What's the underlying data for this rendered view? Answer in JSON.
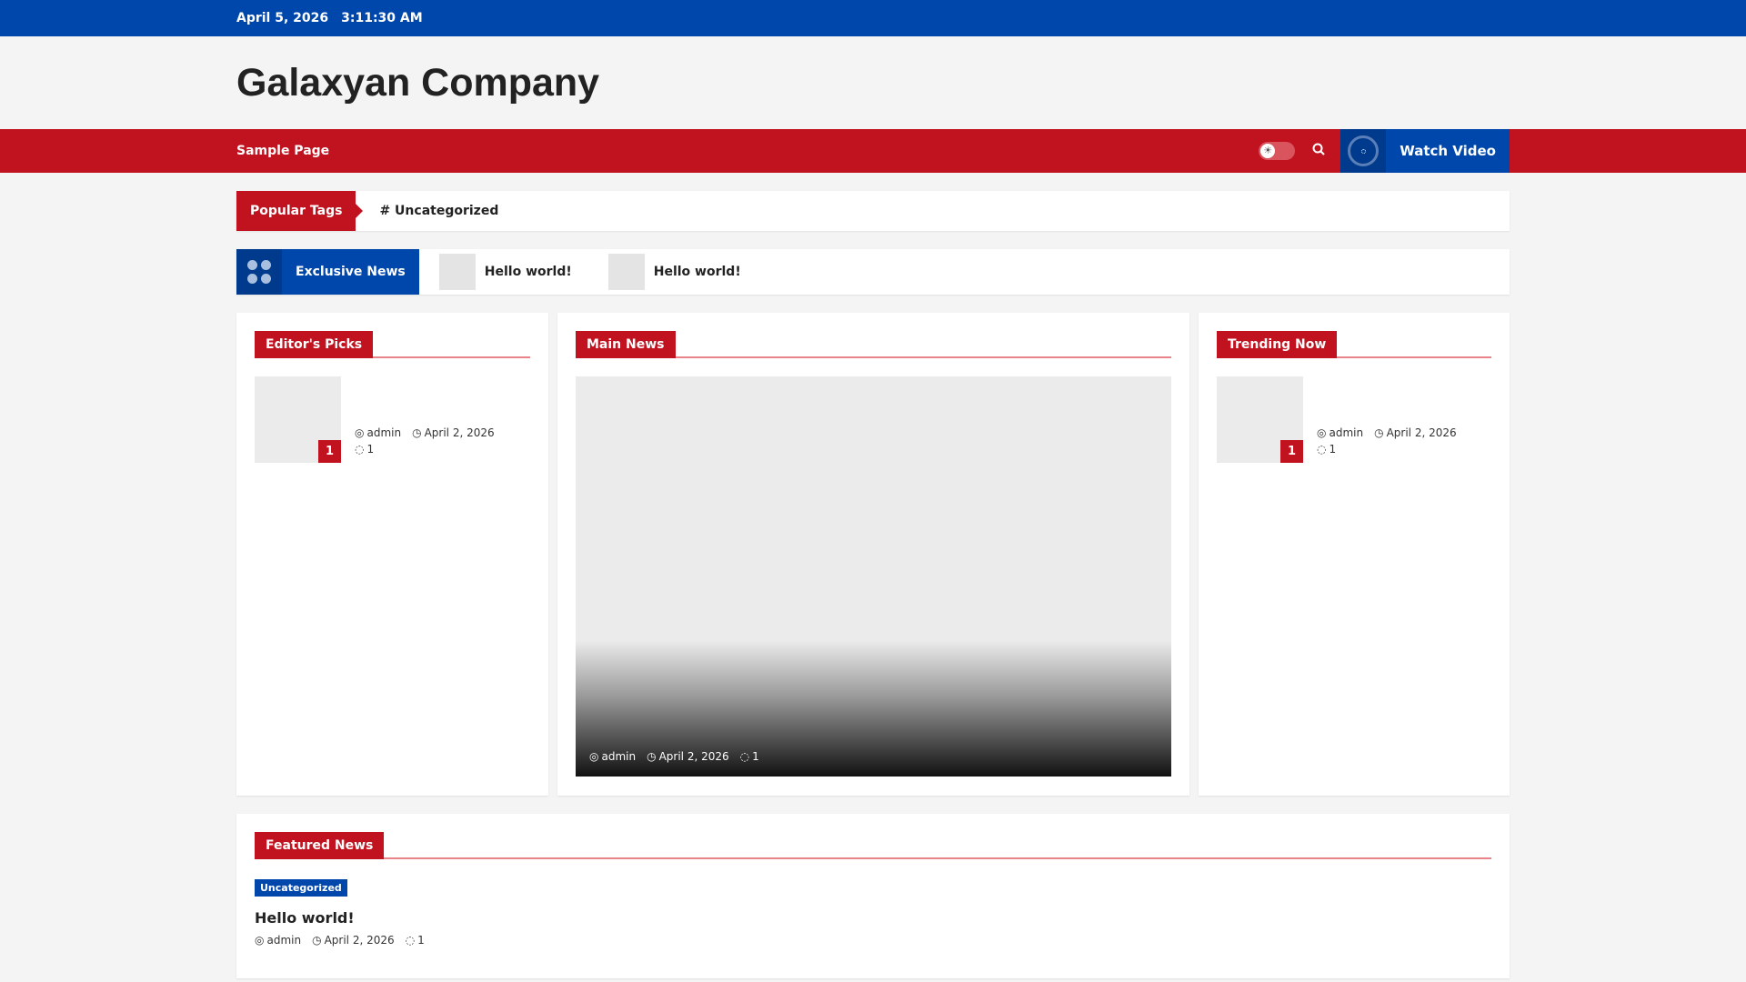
{
  "topbar": {
    "date": "April 5, 2026",
    "time": "3:11:30 AM"
  },
  "site": {
    "title": "Galaxyan Company"
  },
  "nav": {
    "items": [
      "Sample Page"
    ],
    "watch_video": "Watch Video"
  },
  "popular_tags": {
    "label": "Popular Tags",
    "tags": [
      "# Uncategorized"
    ]
  },
  "ticker": {
    "label": "Exclusive News",
    "items": [
      "Hello world!",
      "Hello world!"
    ]
  },
  "editors_picks": {
    "title": "Editor's Picks",
    "posts": [
      {
        "rank": "1",
        "author": "admin",
        "date": "April 2, 2026",
        "comments": "1"
      }
    ]
  },
  "main_news": {
    "title": "Main News",
    "post": {
      "author": "admin",
      "date": "April 2, 2026",
      "comments": "1"
    }
  },
  "trending": {
    "title": "Trending Now",
    "posts": [
      {
        "rank": "1",
        "author": "admin",
        "date": "April 2, 2026",
        "comments": "1"
      }
    ]
  },
  "featured": {
    "title": "Featured News",
    "posts": [
      {
        "category": "Uncategorized",
        "title": "Hello world!",
        "author": "admin",
        "date": "April 2, 2026",
        "comments": "1"
      }
    ]
  },
  "colors": {
    "blue": "#0047ab",
    "red": "#c1121f"
  }
}
